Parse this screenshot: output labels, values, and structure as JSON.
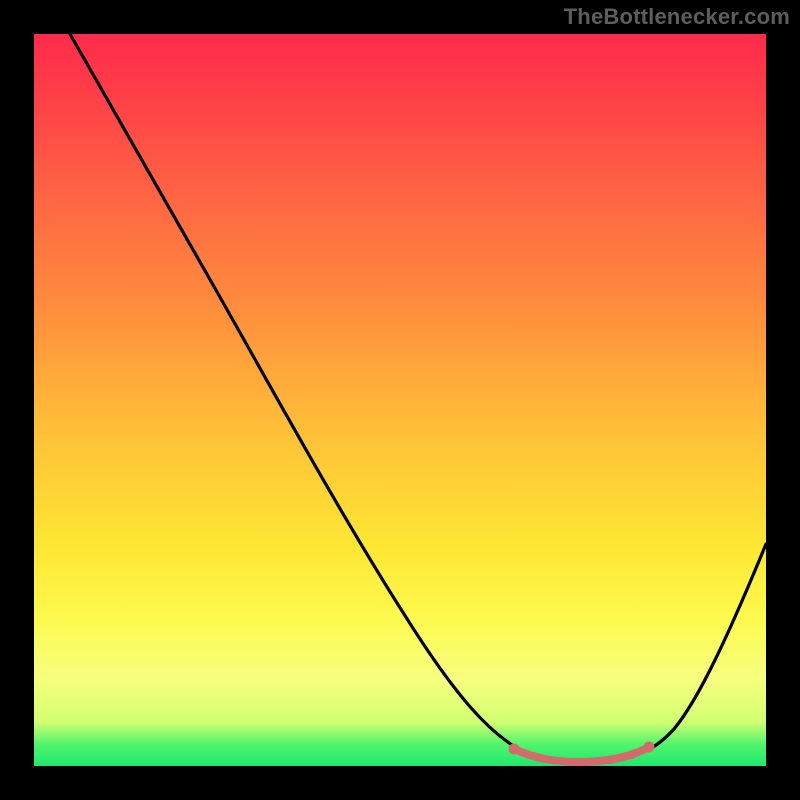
{
  "attribution": "TheBottlenecker.com",
  "chart_data": {
    "type": "line",
    "title": "",
    "xlabel": "",
    "ylabel": "",
    "xlim": [
      0,
      100
    ],
    "ylim": [
      0,
      100
    ],
    "series": [
      {
        "name": "curve",
        "x": [
          5,
          12,
          20,
          30,
          40,
          50,
          58,
          64,
          68,
          72,
          76,
          80,
          84,
          88,
          92,
          96,
          100
        ],
        "y": [
          100,
          93,
          80,
          63,
          46,
          29,
          16,
          7,
          3,
          1,
          1,
          1,
          3,
          9,
          18,
          29,
          40
        ]
      },
      {
        "name": "highlight",
        "x": [
          68,
          72,
          76,
          80,
          84
        ],
        "y": [
          3,
          1,
          1,
          1,
          3
        ]
      }
    ],
    "gradient_stops": [
      {
        "pos": 0,
        "color": "#ff2b4a"
      },
      {
        "pos": 8,
        "color": "#ff3e48"
      },
      {
        "pos": 22,
        "color": "#ff6443"
      },
      {
        "pos": 38,
        "color": "#ff8f3d"
      },
      {
        "pos": 55,
        "color": "#ffc238"
      },
      {
        "pos": 70,
        "color": "#fee733"
      },
      {
        "pos": 80,
        "color": "#fdfa4f"
      },
      {
        "pos": 88,
        "color": "#f7ff7e"
      },
      {
        "pos": 94,
        "color": "#d2ff72"
      },
      {
        "pos": 97,
        "color": "#52f56c"
      },
      {
        "pos": 100,
        "color": "#1ee86e"
      }
    ],
    "highlight_color": "#d46a6a",
    "curve_color": "#000000"
  }
}
